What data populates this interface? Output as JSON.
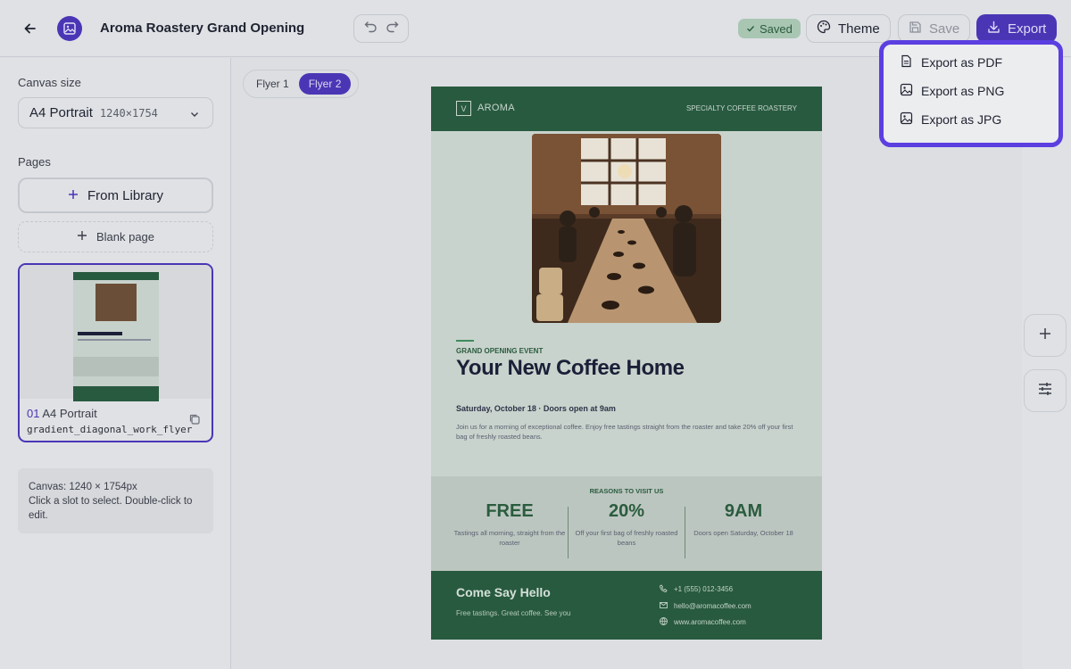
{
  "header": {
    "title": "Aroma Roastery Grand Opening",
    "saved_label": "Saved",
    "theme_label": "Theme",
    "save_label": "Save",
    "export_label": "Export"
  },
  "export_menu": {
    "items": [
      "Export as PDF",
      "Export as PNG",
      "Export as JPG"
    ]
  },
  "sidebar": {
    "canvas_size_label": "Canvas size",
    "canvas_size_value": "A4 Portrait",
    "canvas_size_dims": "1240×1754",
    "pages_label": "Pages",
    "from_library_label": "From Library",
    "blank_page_label": "Blank page",
    "page_card": {
      "number": "01",
      "name": "A4 Portrait",
      "template": "gradient_diagonal_work_flyer"
    },
    "info_line1": "Canvas: 1240 × 1754px",
    "info_line2": "Click a slot to select. Double-click to edit."
  },
  "tabs": [
    "Flyer 1",
    "Flyer 2"
  ],
  "active_tab": "Flyer 2",
  "flyer": {
    "brand_box": "V",
    "brand": "AROMA",
    "tagline": "SPECIALTY COFFEE ROASTERY",
    "event_label": "GRAND OPENING EVENT",
    "title": "Your New Coffee Home",
    "date": "Saturday, October 18 · Doors open at 9am",
    "description": "Join us for a morning of exceptional coffee. Enjoy free tastings straight from the roaster and take 20% off your first bag of freshly roasted beans.",
    "reasons_title": "REASONS TO VISIT US",
    "reasons": [
      {
        "big": "FREE",
        "small": "Tastings all morning, straight from the roaster"
      },
      {
        "big": "20%",
        "small": "Off your first bag of freshly roasted beans"
      },
      {
        "big": "9AM",
        "small": "Doors open Saturday, October 18"
      }
    ],
    "footer_title": "Come Say Hello",
    "footer_sub": "Free tastings. Great coffee. See you",
    "phone": "+1 (555) 012-3456",
    "email": "hello@aromacoffee.com",
    "web": "www.aromacoffee.com"
  },
  "colors": {
    "accent": "#4a36b5",
    "flyer_green": "#285a3f",
    "menu_highlight": "#5b3fe0"
  }
}
